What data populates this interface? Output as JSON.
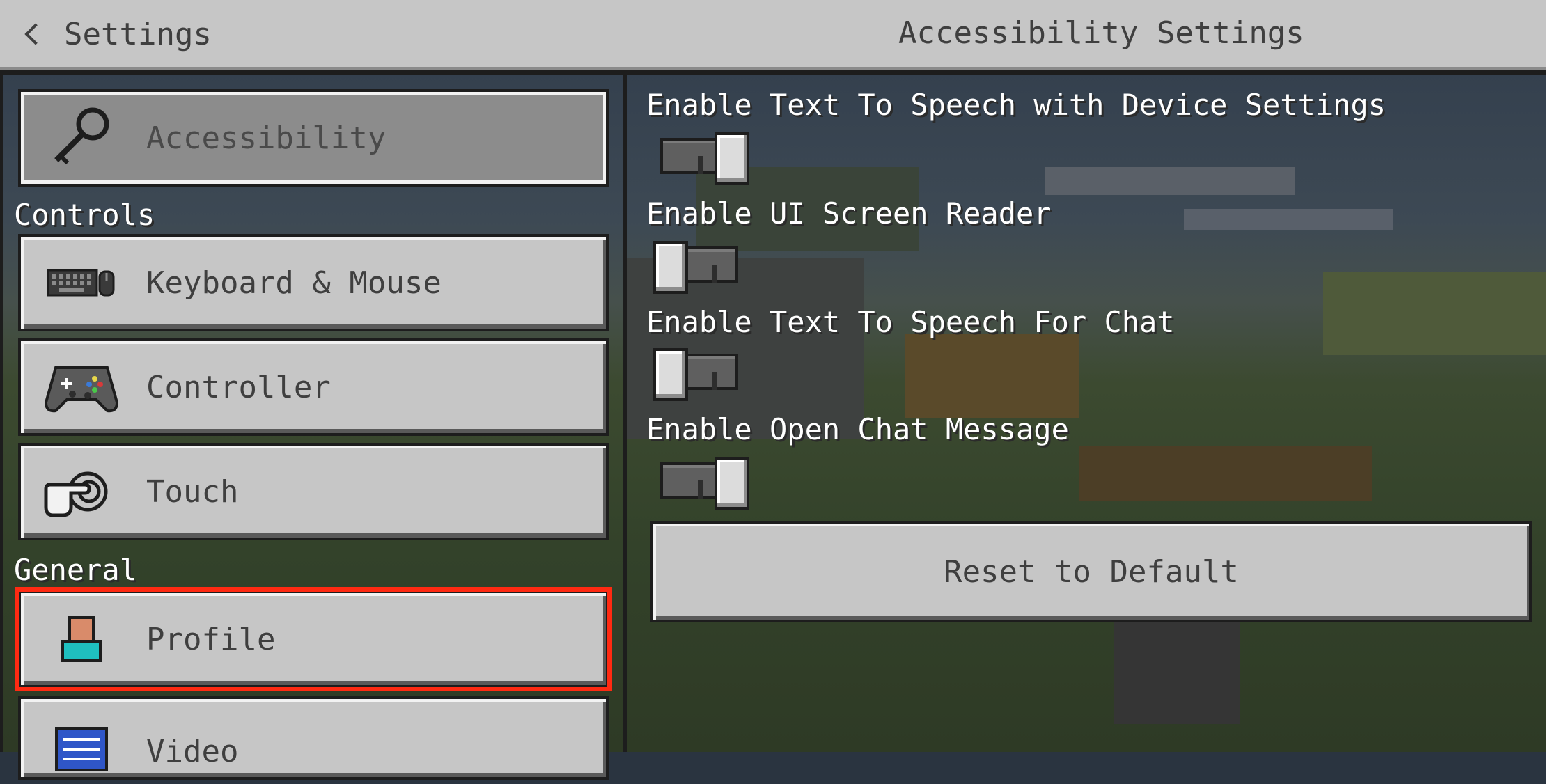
{
  "header": {
    "back_label": "Settings",
    "title": "Accessibility Settings"
  },
  "sidebar": {
    "top_item": {
      "label": "Accessibility",
      "icon": "key-icon",
      "selected": true
    },
    "sections": [
      {
        "label": "Controls",
        "items": [
          {
            "label": "Keyboard & Mouse",
            "icon": "keyboard-mouse-icon"
          },
          {
            "label": "Controller",
            "icon": "gamepad-icon"
          },
          {
            "label": "Touch",
            "icon": "touch-hand-icon"
          }
        ]
      },
      {
        "label": "General",
        "items": [
          {
            "label": "Profile",
            "icon": "profile-icon",
            "highlighted": true
          },
          {
            "label": "Video",
            "icon": "video-sliders-icon"
          }
        ]
      }
    ]
  },
  "options": [
    {
      "label": "Enable Text To Speech with Device Settings",
      "enabled": true
    },
    {
      "label": "Enable UI Screen Reader",
      "enabled": false
    },
    {
      "label": "Enable Text To Speech For Chat",
      "enabled": false
    },
    {
      "label": "Enable Open Chat Message",
      "enabled": true
    }
  ],
  "reset_label": "Reset to Default",
  "colors": {
    "highlight": "#ff2a12",
    "button": "#c6c6c6",
    "selected_button": "#8c8c8c",
    "topbar": "#c6c6c6"
  }
}
